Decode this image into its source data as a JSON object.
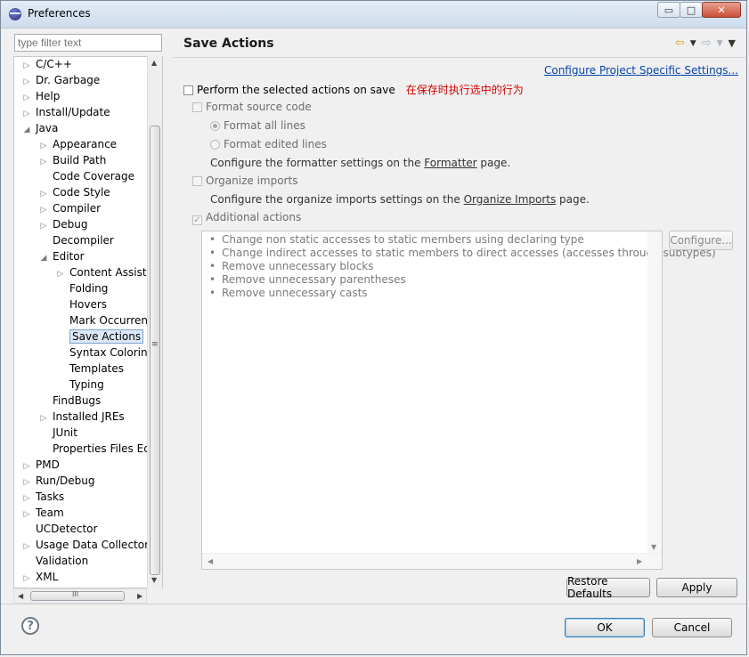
{
  "window": {
    "title": "Preferences",
    "minimize": "▭",
    "maximize": "□",
    "close": "✕"
  },
  "filter": {
    "placeholder": "type filter text"
  },
  "tree": {
    "items": [
      {
        "label": "C/C++",
        "level": 0,
        "twisty": "▷"
      },
      {
        "label": "Dr. Garbage",
        "level": 0,
        "twisty": "▷"
      },
      {
        "label": "Help",
        "level": 0,
        "twisty": "▷"
      },
      {
        "label": "Install/Update",
        "level": 0,
        "twisty": "▷"
      },
      {
        "label": "Java",
        "level": 0,
        "twisty": "◢"
      },
      {
        "label": "Appearance",
        "level": 1,
        "twisty": "▷"
      },
      {
        "label": "Build Path",
        "level": 1,
        "twisty": "▷"
      },
      {
        "label": "Code Coverage",
        "level": 1,
        "twisty": ""
      },
      {
        "label": "Code Style",
        "level": 1,
        "twisty": "▷"
      },
      {
        "label": "Compiler",
        "level": 1,
        "twisty": "▷"
      },
      {
        "label": "Debug",
        "level": 1,
        "twisty": "▷"
      },
      {
        "label": "Decompiler",
        "level": 1,
        "twisty": ""
      },
      {
        "label": "Editor",
        "level": 1,
        "twisty": "◢"
      },
      {
        "label": "Content Assist",
        "level": 2,
        "twisty": "▷"
      },
      {
        "label": "Folding",
        "level": 2,
        "twisty": ""
      },
      {
        "label": "Hovers",
        "level": 2,
        "twisty": ""
      },
      {
        "label": "Mark Occurrences",
        "level": 2,
        "twisty": ""
      },
      {
        "label": "Save Actions",
        "level": 2,
        "twisty": "",
        "selected": true
      },
      {
        "label": "Syntax Coloring",
        "level": 2,
        "twisty": ""
      },
      {
        "label": "Templates",
        "level": 2,
        "twisty": ""
      },
      {
        "label": "Typing",
        "level": 2,
        "twisty": ""
      },
      {
        "label": "FindBugs",
        "level": 1,
        "twisty": ""
      },
      {
        "label": "Installed JREs",
        "level": 1,
        "twisty": "▷"
      },
      {
        "label": "JUnit",
        "level": 1,
        "twisty": ""
      },
      {
        "label": "Properties Files Editor",
        "level": 1,
        "twisty": ""
      },
      {
        "label": "PMD",
        "level": 0,
        "twisty": "▷"
      },
      {
        "label": "Run/Debug",
        "level": 0,
        "twisty": "▷"
      },
      {
        "label": "Tasks",
        "level": 0,
        "twisty": "▷"
      },
      {
        "label": "Team",
        "level": 0,
        "twisty": "▷"
      },
      {
        "label": "UCDetector",
        "level": 0,
        "twisty": ""
      },
      {
        "label": "Usage Data Collector",
        "level": 0,
        "twisty": "▷"
      },
      {
        "label": "Validation",
        "level": 0,
        "twisty": ""
      },
      {
        "label": "XML",
        "level": 0,
        "twisty": "▷"
      }
    ],
    "vscroll_grip": "≡",
    "hscroll_grip": "III",
    "up_arrow": "▲",
    "down_arrow": "▼",
    "left_arrow": "◀",
    "right_arrow": "▶"
  },
  "page": {
    "title": "Save Actions",
    "nav": {
      "back_icon": "⇦",
      "forward_icon": "⇨",
      "dropdown_icon": "▼",
      "menu_icon": "▼"
    },
    "configure_link": "Configure Project Specific Settings...",
    "perform_label": "Perform the selected actions on save",
    "annotation": "在保存时执行选中的行为",
    "format_source_label": "Format source code",
    "format_all_label": "Format all lines",
    "format_edited_label": "Format edited lines",
    "formatter_text_before": "Configure the formatter settings on the ",
    "formatter_link": "Formatter",
    "formatter_text_after": " page.",
    "organize_label": "Organize imports",
    "organize_text_before": "Configure the organize imports settings on the ",
    "organize_link": "Organize Imports",
    "organize_text_after": " page.",
    "additional_label": "Additional actions",
    "actions": [
      "Change non static accesses to static members using declaring type",
      "Change indirect accesses to static members to direct accesses (accesses through subtypes)",
      "Remove unnecessary blocks",
      "Remove unnecessary parentheses",
      "Remove unnecessary casts"
    ],
    "bullet": "•",
    "configure_button": "Configure...",
    "restore_defaults_button": "Restore Defaults",
    "apply_button": "Apply"
  },
  "footer": {
    "help_icon": "?",
    "ok_button": "OK",
    "cancel_button": "Cancel"
  }
}
